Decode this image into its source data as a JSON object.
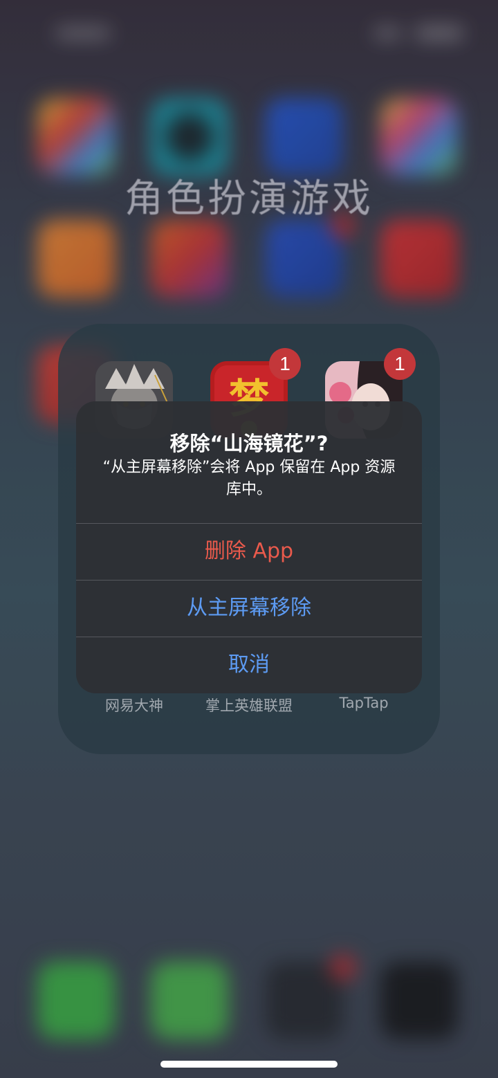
{
  "folder": {
    "title": "角色扮演游戏",
    "apps": [
      {
        "label": "网易大神",
        "badge": ""
      },
      {
        "label": "掌上英雄联盟",
        "badge": "1"
      },
      {
        "label": "TapTap",
        "badge": "1"
      }
    ]
  },
  "alert": {
    "title": "移除“山海镜花”?",
    "message": "“从主屏幕移除”会将 App 保留在 App 资源库中。",
    "buttons": {
      "delete": "删除 App",
      "remove_home": "从主屏幕移除",
      "cancel": "取消"
    }
  },
  "colors": {
    "destructive": "#ea5a4c",
    "action": "#5d9bf3",
    "badge": "#c3373a"
  }
}
